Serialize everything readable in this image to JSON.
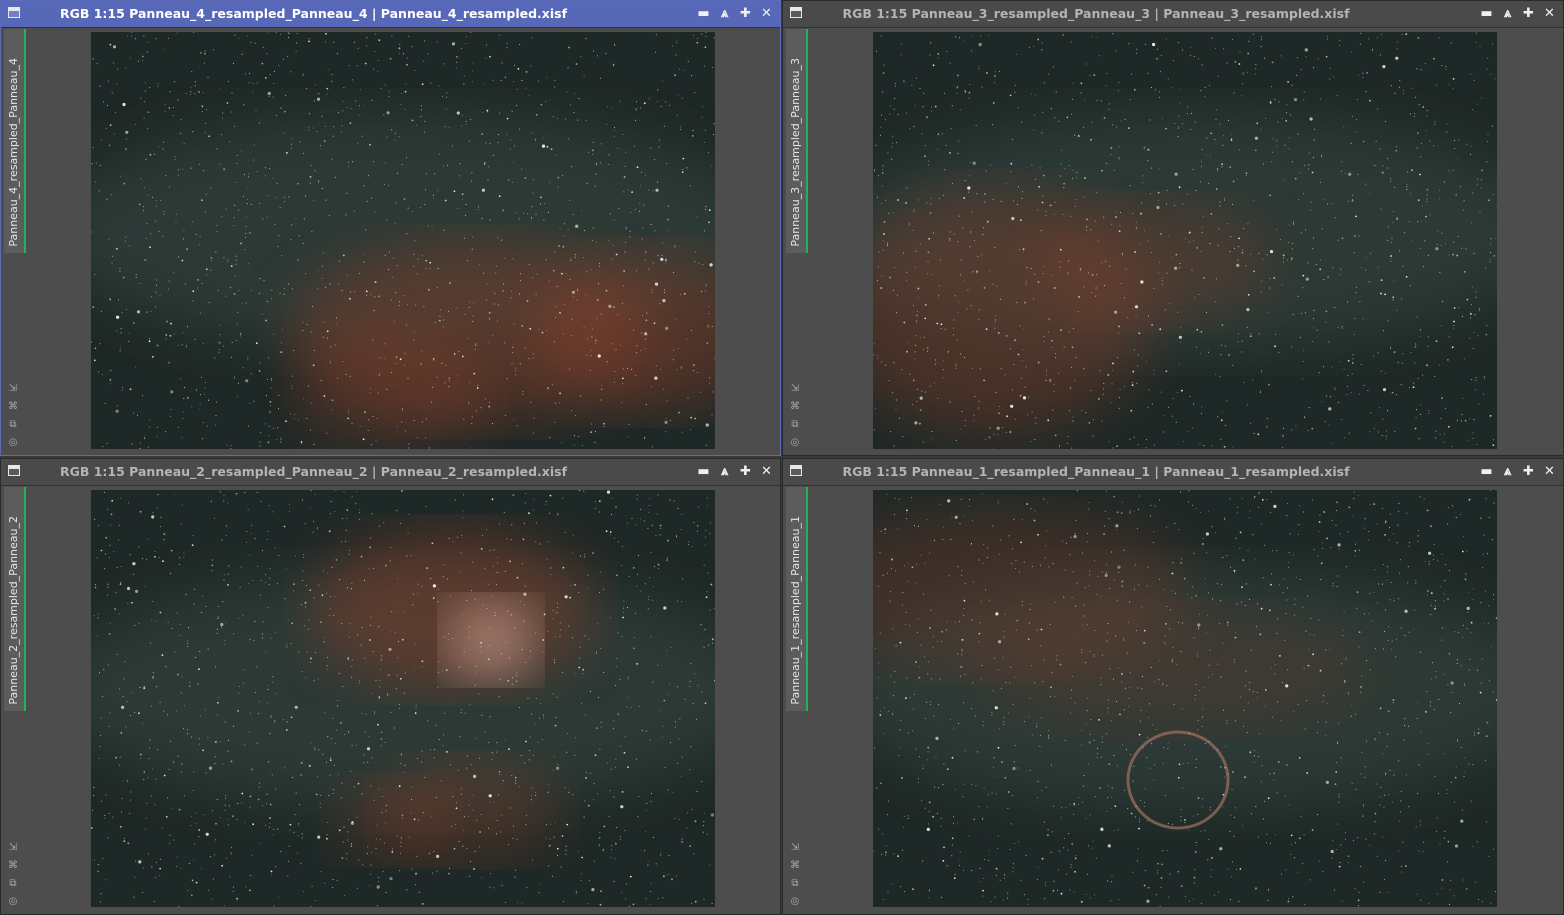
{
  "windows": [
    {
      "id": "w4",
      "active": true,
      "title": "RGB 1:15 Panneau_4_resampled_Panneau_4 | Panneau_4_resampled.xisf",
      "tab": "Panneau_4_resampled_Panneau_4",
      "image": "astro-milky-way-cygnus-nebulae"
    },
    {
      "id": "w3",
      "active": false,
      "title": "RGB 1:15 Panneau_3_resampled_Panneau_3 | Panneau_3_resampled.xisf",
      "tab": "Panneau_3_resampled_Panneau_3",
      "image": "astro-milky-way-dark-lanes"
    },
    {
      "id": "w2",
      "active": false,
      "title": "RGB 1:15 Panneau_2_resampled_Panneau_2 | Panneau_2_resampled.xisf",
      "tab": "Panneau_2_resampled_Panneau_2",
      "image": "astro-north-america-nebula"
    },
    {
      "id": "w1",
      "active": false,
      "title": "RGB 1:15 Panneau_1_resampled_Panneau_1 | Panneau_1_resampled.xisf",
      "tab": "Panneau_1_resampled_Panneau_1",
      "image": "astro-veil-nebula"
    }
  ],
  "controls": {
    "minimize": "▬",
    "shade": "⩓",
    "maximize": "✚",
    "close": "✕"
  },
  "colors": {
    "active_title": "#5868b8",
    "tab_accent": "#21b35b",
    "sky": "#1e2826"
  }
}
